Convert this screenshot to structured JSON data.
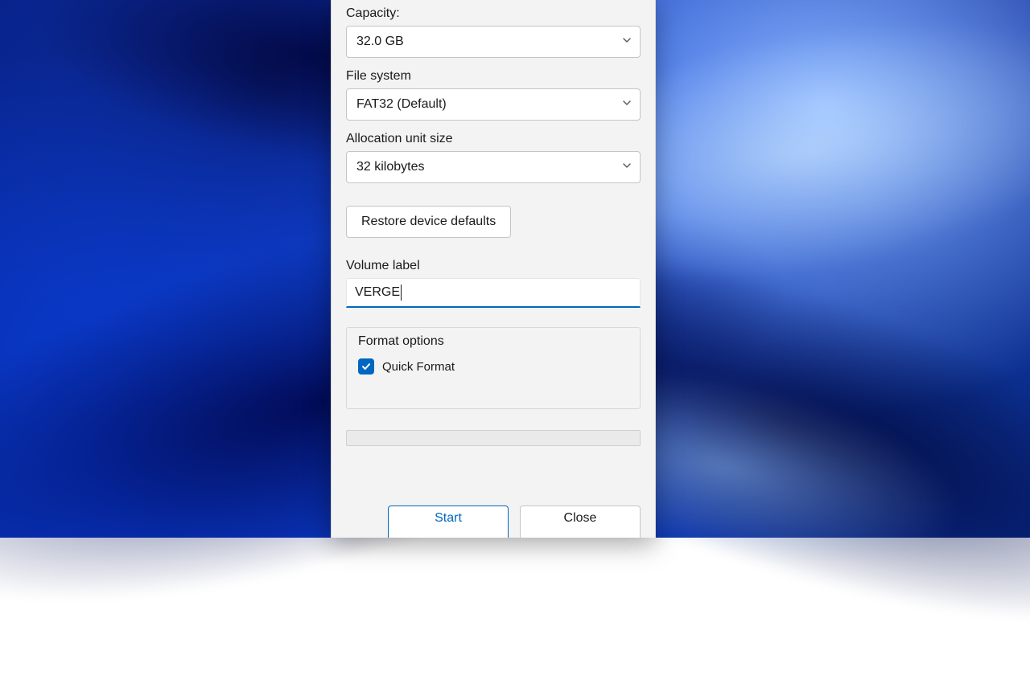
{
  "labels": {
    "capacity": "Capacity:",
    "file_system": "File system",
    "allocation": "Allocation unit size",
    "volume_label": "Volume label",
    "format_options": "Format options"
  },
  "values": {
    "capacity": "32.0 GB",
    "file_system": "FAT32 (Default)",
    "allocation": "32 kilobytes",
    "volume_label": "VERGE"
  },
  "buttons": {
    "restore_defaults": "Restore device defaults",
    "start": "Start",
    "close": "Close"
  },
  "options": {
    "quick_format": "Quick Format",
    "quick_format_checked": true
  }
}
